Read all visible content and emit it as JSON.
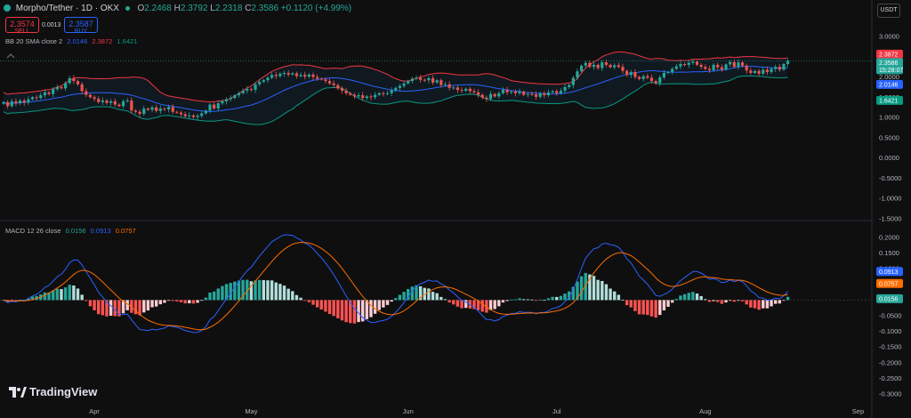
{
  "header": {
    "symbol": "Morpho/Tether · 1D · OKX",
    "ohlc": [
      {
        "k": "O",
        "v": "2.2468"
      },
      {
        "k": "H",
        "v": "2.3792"
      },
      {
        "k": "L",
        "v": "2.2318"
      },
      {
        "k": "C",
        "v": "2.3586"
      }
    ],
    "change": "+0.1120 (+4.99%)",
    "currency": "USDT"
  },
  "trade": {
    "sell_price": "2.3574",
    "sell_label": "SELL",
    "spread": "0.0013",
    "buy_price": "2.3587",
    "buy_label": "BUY"
  },
  "bb_legend": {
    "name": "BB 20 SMA close 2",
    "basis": "2.0146",
    "upper": "2.3872",
    "lower": "1.6421"
  },
  "macd_legend": {
    "name": "MACD 12 26 close",
    "hist": "0.0156",
    "macd": "0.0913",
    "signal": "0.0757"
  },
  "price_badges": {
    "upper": "2.3872",
    "last": "2.3586",
    "countdown": "15:28:07",
    "basis": "2.0146",
    "lower": "1.6421"
  },
  "macd_badges": {
    "macd": "0.0913",
    "signal": "0.0757",
    "hist": "0.0156"
  },
  "colors": {
    "bg": "#0f0f0f",
    "up": "#26a69a",
    "down": "#ef5350",
    "bb_upper": "#f23645",
    "bb_basis": "#2962ff",
    "bb_lower": "#089981",
    "macd": "#2962ff",
    "signal": "#ff6d00"
  },
  "logo": "TradingView",
  "chart_data": [
    {
      "type": "candlestick",
      "title": "Morpho/Tether · 1D · OKX",
      "x_ticks": [
        "Apr",
        "May",
        "Jun",
        "Jul",
        "Aug",
        "Sep"
      ],
      "y_ticks": [
        "3.0000",
        "2.5000",
        "2.0000",
        "1.5000",
        "1.0000",
        "0.5000",
        "0.0000",
        "-0.5000",
        "-1.0000",
        "-1.5000"
      ],
      "ylim": [
        -1.5,
        3.0
      ],
      "close": [
        1.38,
        1.28,
        1.4,
        1.35,
        1.42,
        1.37,
        1.45,
        1.5,
        1.48,
        1.55,
        1.62,
        1.58,
        1.7,
        1.75,
        1.72,
        1.85,
        1.97,
        1.9,
        1.82,
        1.65,
        1.56,
        1.5,
        1.46,
        1.38,
        1.42,
        1.36,
        1.4,
        1.32,
        1.28,
        1.4,
        1.42,
        1.17,
        1.14,
        1.09,
        1.22,
        1.19,
        1.25,
        1.16,
        1.22,
        1.2,
        1.26,
        1.14,
        1.12,
        1.08,
        1.03,
        1.05,
        1.01,
        1.04,
        1.1,
        1.17,
        1.32,
        1.22,
        1.35,
        1.4,
        1.45,
        1.48,
        1.55,
        1.6,
        1.66,
        1.7,
        1.68,
        1.82,
        1.88,
        1.92,
        1.98,
        2.05,
        2.02,
        2.08,
        2.1,
        2.06,
        2.09,
        2.02,
        2.05,
        2.01,
        2.06,
        2.0,
        1.96,
        1.94,
        1.9,
        1.84,
        1.8,
        1.72,
        1.66,
        1.6,
        1.56,
        1.52,
        1.55,
        1.48,
        1.52,
        1.5,
        1.56,
        1.6,
        1.58,
        1.6,
        1.67,
        1.73,
        1.78,
        1.84,
        1.9,
        1.96,
        1.98,
        1.93,
        1.92,
        1.97,
        1.86,
        1.92,
        1.8,
        1.82,
        1.73,
        1.74,
        1.68,
        1.66,
        1.71,
        1.65,
        1.62,
        1.56,
        1.49,
        1.46,
        1.58,
        1.52,
        1.6,
        1.68,
        1.62,
        1.64,
        1.6,
        1.64,
        1.56,
        1.58,
        1.57,
        1.51,
        1.6,
        1.55,
        1.62,
        1.65,
        1.6,
        1.66,
        1.75,
        1.8,
        1.98,
        2.14,
        2.28,
        2.35,
        2.25,
        2.3,
        2.22,
        2.36,
        2.3,
        2.24,
        2.29,
        2.25,
        2.15,
        2.05,
        2.12,
        2.0,
        1.95,
        2.02,
        1.98,
        1.9,
        1.85,
        1.99,
        2.1,
        2.12,
        2.2,
        2.26,
        2.32,
        2.3,
        2.35,
        2.38,
        2.3,
        2.25,
        2.2,
        2.17,
        2.3,
        2.24,
        2.18,
        2.31,
        2.37,
        2.25,
        2.36,
        2.28,
        2.16,
        2.1,
        2.15,
        2.08,
        2.18,
        2.12,
        2.2,
        2.25,
        2.18,
        2.32,
        2.4
      ]
    },
    {
      "type": "bar",
      "title": "MACD 12 26 close",
      "y_ticks": [
        "0.2000",
        "0.1500",
        "0.1000",
        "0.0500",
        "0.0000",
        "-0.0500",
        "-0.1000",
        "-0.1500",
        "-0.2000",
        "-0.2500",
        "-0.3000"
      ],
      "ylim": [
        -0.32,
        0.22
      ]
    }
  ]
}
